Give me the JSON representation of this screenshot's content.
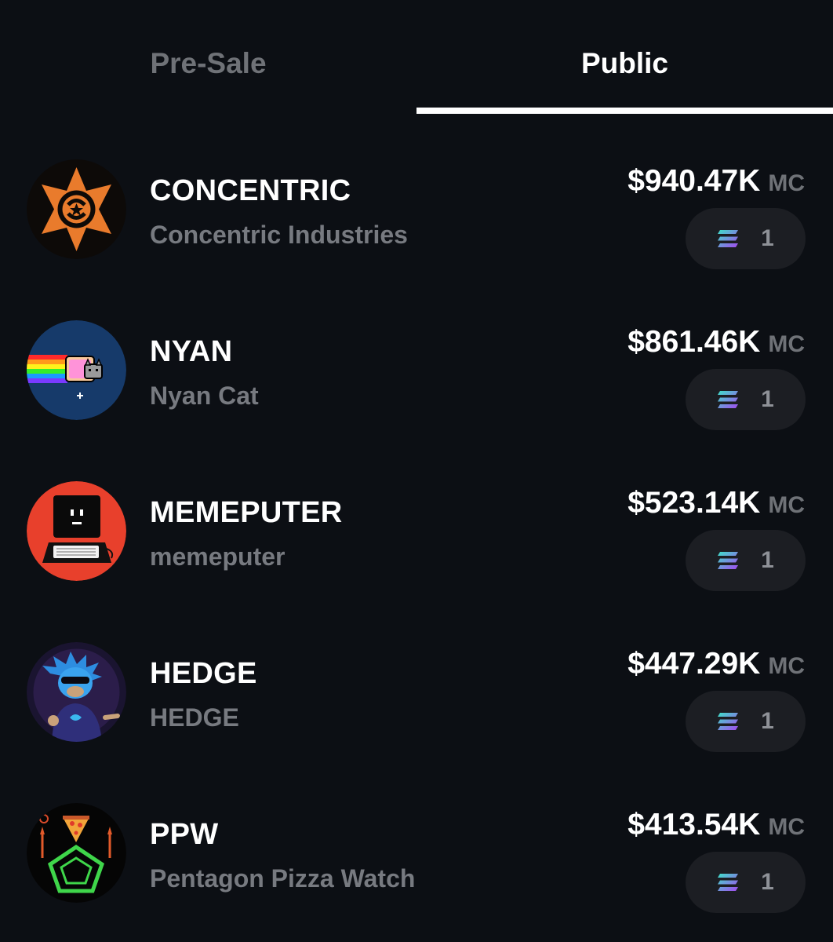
{
  "tabs": [
    {
      "label": "Pre-Sale",
      "active": false
    },
    {
      "label": "Public",
      "active": true
    }
  ],
  "tokens": [
    {
      "ticker": "CONCENTRIC",
      "name": "Concentric Industries",
      "market_cap": "$940.47K",
      "mc_unit": "MC",
      "count": "1",
      "avatar_icon": "concentric-star-logo-icon"
    },
    {
      "ticker": "NYAN",
      "name": "Nyan Cat",
      "market_cap": "$861.46K",
      "mc_unit": "MC",
      "count": "1",
      "avatar_icon": "nyan-cat-icon"
    },
    {
      "ticker": "MEMEPUTER",
      "name": "memeputer",
      "market_cap": "$523.14K",
      "mc_unit": "MC",
      "count": "1",
      "avatar_icon": "retro-computer-icon"
    },
    {
      "ticker": "HEDGE",
      "name": "HEDGE",
      "market_cap": "$447.29K",
      "mc_unit": "MC",
      "count": "1",
      "avatar_icon": "hedgehog-character-icon"
    },
    {
      "ticker": "PPW",
      "name": "Pentagon Pizza Watch",
      "market_cap": "$413.54K",
      "mc_unit": "MC",
      "count": "1",
      "avatar_icon": "pizza-pentagon-icon"
    }
  ],
  "colors": {
    "background": "#0c0f14",
    "pill": "#1c1e23",
    "muted_text": "#777a80",
    "active_tab": "#ffffff"
  }
}
